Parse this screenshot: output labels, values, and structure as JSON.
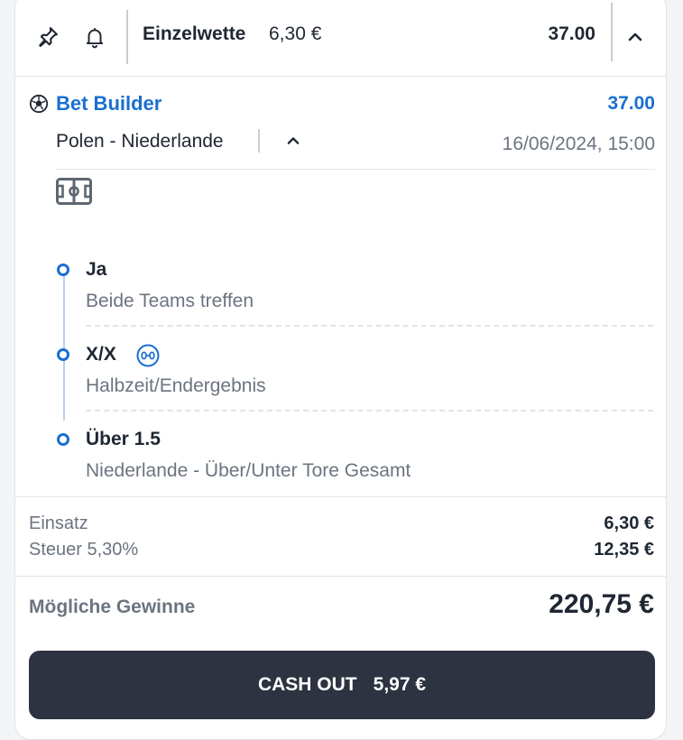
{
  "header": {
    "bet_type": "Einzelwette",
    "stake": "6,30 €",
    "odds": "37.00",
    "pin_icon": "pin-icon",
    "bell_icon": "bell-icon",
    "collapse_icon": "chevron-up-icon"
  },
  "bet_builder": {
    "title": "Bet Builder",
    "odds": "37.00",
    "match": "Polen - Niederlande",
    "datetime": "16/06/2024, 15:00",
    "sport_icon": "soccer-ball-icon",
    "field_icon": "football-pitch-icon",
    "selections": [
      {
        "name": "Ja",
        "market": "Beide Teams treffen"
      },
      {
        "name": "X/X",
        "market": "Halbzeit/Endergebnis",
        "badge_icon": "score-icon"
      },
      {
        "name": "Über 1.5",
        "market": "Niederlande - Über/Unter Tore Gesamt"
      }
    ]
  },
  "summary": {
    "stake_label": "Einsatz",
    "stake_value": "6,30 €",
    "tax_label": "Steuer 5,30%",
    "tax_value": "12,35 €",
    "winnings_label": "Mögliche Gewinne",
    "winnings_value": "220,75 €"
  },
  "cashout": {
    "label": "CASH OUT",
    "amount": "5,97 €"
  },
  "colors": {
    "accent": "#1a6fd1",
    "button": "#2d3340",
    "muted_text": "#6b7480"
  }
}
